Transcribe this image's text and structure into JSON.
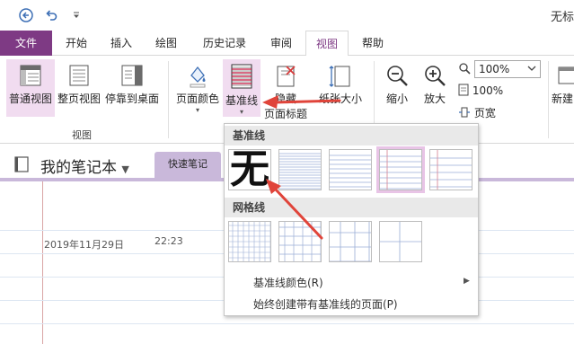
{
  "titlebar": {
    "back_icon": "circle-back-arrow-icon",
    "undo_icon": "undo-icon",
    "customize_icon": "customize-quick-access-icon",
    "app_title": "无标"
  },
  "tabs": [
    {
      "label": "文件"
    },
    {
      "label": "开始"
    },
    {
      "label": "插入"
    },
    {
      "label": "绘图"
    },
    {
      "label": "历史记录"
    },
    {
      "label": "审阅"
    },
    {
      "label": "视图"
    },
    {
      "label": "帮助"
    }
  ],
  "ribbon": {
    "normal_view": "普通视图",
    "full_page_view": "整页视图",
    "dock_to_desktop": "停靠到桌面",
    "views_group": "视图",
    "page_color": "页面颜色",
    "rule_lines": "基准线",
    "hide_page_title_1": "隐藏",
    "hide_page_title_2": "页面标题",
    "paper_size": "纸张大小",
    "zoom_out": "缩小",
    "zoom_in": "放大",
    "zoom_value": "100%",
    "zoom_100": "100%",
    "page_width": "页宽",
    "new_window": "新建"
  },
  "notebook": {
    "title": "我的笔记本",
    "section_tab": "快速笔记"
  },
  "page": {
    "date": "2019年11月29日",
    "time": "22:23"
  },
  "dropdown": {
    "rule_lines_header": "基准线",
    "none_label": "无",
    "grid_lines_header": "网格线",
    "rule_line_color": "基准线颜色(R)",
    "always_create": "始终创建带有基准线的页面(P)"
  },
  "colors": {
    "file_tab": "#7e3a84",
    "accent": "#7e3a84",
    "section": "#c9b8da",
    "annotation_arrow": "#e0443a",
    "selected_highlight": "#f1dcf0"
  }
}
